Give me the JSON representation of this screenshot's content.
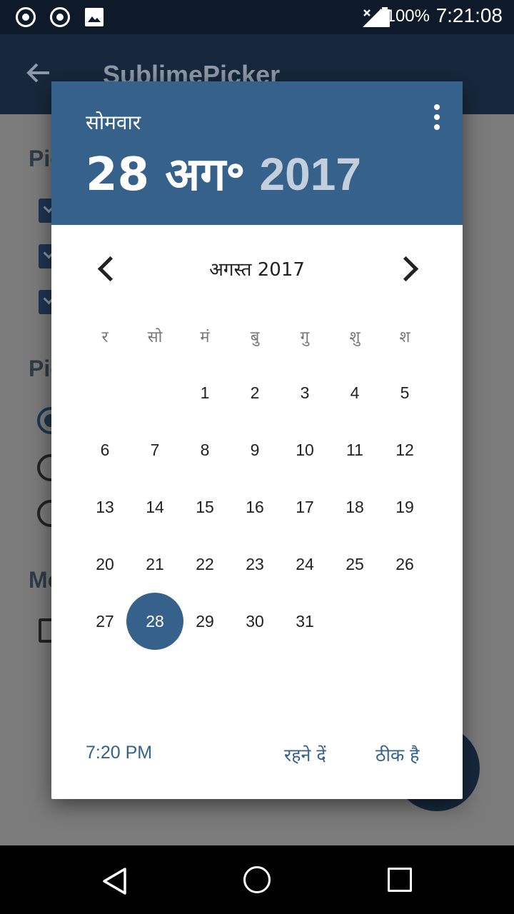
{
  "status_bar": {
    "icons": [
      "record-icon",
      "record-icon",
      "image-icon",
      "signal-icon",
      "battery-icon"
    ],
    "battery": "100%",
    "time": "7:21:08"
  },
  "app_bar": {
    "back_icon": "arrow-back-icon",
    "title": "SublimePicker"
  },
  "background": {
    "headings": [
      "Pic",
      "Pic",
      "Mo"
    ],
    "fab_color": "#17283c"
  },
  "dialog": {
    "header": {
      "day_of_week": "सोमवार",
      "date": "28 अग॰",
      "year": "2017",
      "overflow_icon": "more-vert-icon"
    },
    "month_label": "अगस्त 2017",
    "weekdays": [
      "र",
      "सो",
      "मं",
      "बु",
      "गु",
      "शु",
      "श"
    ],
    "days": [
      "",
      "",
      "1",
      "2",
      "3",
      "4",
      "5",
      "6",
      "7",
      "8",
      "9",
      "10",
      "11",
      "12",
      "13",
      "14",
      "15",
      "16",
      "17",
      "18",
      "19",
      "20",
      "21",
      "22",
      "23",
      "24",
      "25",
      "26",
      "27",
      "28",
      "29",
      "30",
      "31"
    ],
    "selected_day": "28",
    "footer": {
      "time": "7:20 PM",
      "cancel": "रहने दें",
      "ok": "ठीक है"
    },
    "accent": "#35618a"
  },
  "nav_bar": {
    "icons": [
      "back-triangle-icon",
      "home-circle-icon",
      "recents-square-icon"
    ]
  }
}
